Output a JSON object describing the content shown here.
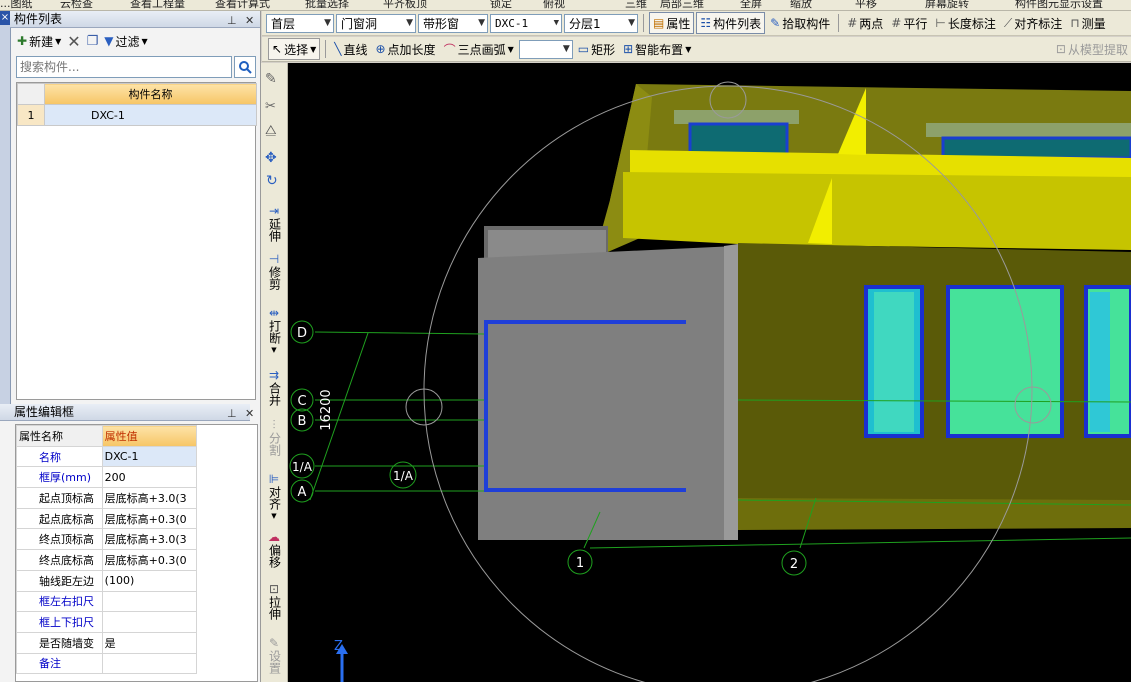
{
  "top_strip": [
    "...图纸",
    "云检查",
    "查看工程量",
    "查看计算式",
    "批量选择",
    "平齐板顶",
    "锁定",
    "俯视",
    "三维",
    "局部三维",
    "全屏",
    "缩放",
    "平移",
    "屏幕旋转",
    "构件图元显示设置"
  ],
  "component_panel": {
    "title": "构件列表",
    "new_label": "新建",
    "filter_label": "过滤",
    "search_placeholder": "搜索构件...",
    "column_header": "构件名称",
    "rows": [
      {
        "index": "1",
        "name": "DXC-1"
      }
    ]
  },
  "property_panel": {
    "title": "属性编辑框",
    "col_name": "属性名称",
    "col_value": "属性值",
    "rows": [
      {
        "name": "名称",
        "value": "DXC-1"
      },
      {
        "name": "框厚(mm)",
        "value": "200"
      },
      {
        "name": "起点顶标高",
        "value": "层底标高+3.0(3"
      },
      {
        "name": "起点底标高",
        "value": "层底标高+0.3(0"
      },
      {
        "name": "终点顶标高",
        "value": "层底标高+3.0(3"
      },
      {
        "name": "终点底标高",
        "value": "层底标高+0.3(0"
      },
      {
        "name": "轴线距左边",
        "value": "(100)"
      },
      {
        "name": "框左右扣尺",
        "value": ""
      },
      {
        "name": "框上下扣尺",
        "value": ""
      },
      {
        "name": "是否随墙变",
        "value": "是"
      },
      {
        "name": "备注",
        "value": ""
      }
    ]
  },
  "toolbar1": {
    "floor": "首层",
    "category": "门窗洞",
    "type": "带形窗",
    "component": "DXC-1",
    "layer": "分层1",
    "properties_btn": "属性",
    "list_btn": "构件列表",
    "pick_btn": "拾取构件",
    "two_point_btn": "两点",
    "parallel_btn": "平行",
    "length_dim_btn": "长度标注",
    "align_dim_btn": "对齐标注",
    "measure_btn": "测量"
  },
  "toolbar2": {
    "select_btn": "选择",
    "line_btn": "直线",
    "point_length_btn": "点加长度",
    "arc_btn": "三点画弧",
    "rect_btn": "矩形",
    "smart_btn": "智能布置",
    "extract_btn": "从模型提取"
  },
  "left_tools": [
    "延伸",
    "修剪",
    "打断",
    "合并",
    "分割",
    "对齐",
    "偏移",
    "拉伸",
    "设置"
  ],
  "viewport": {
    "axis_labels": [
      "D",
      "C",
      "B",
      "1/A",
      "A",
      "1",
      "2"
    ],
    "dimension_label": "16200",
    "float_label": "1/A",
    "z_axis": "Z"
  }
}
